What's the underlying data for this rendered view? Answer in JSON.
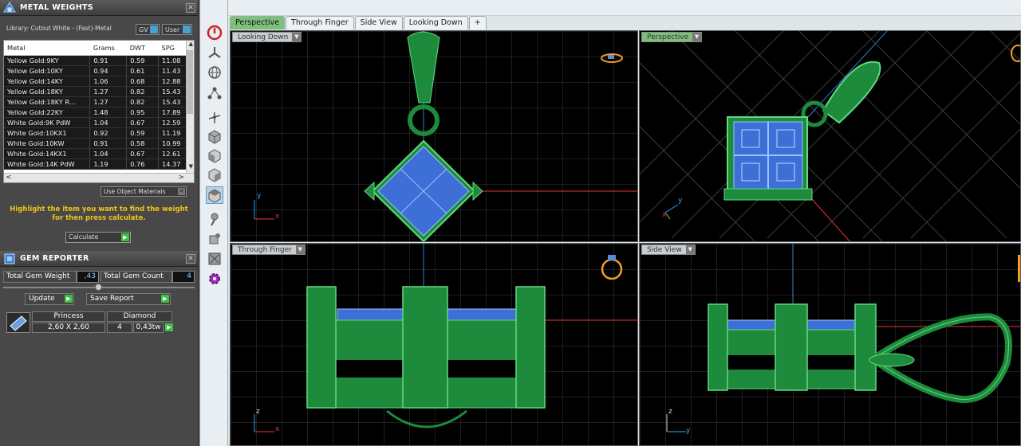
{
  "metal_weights": {
    "title": "METAL WEIGHTS",
    "library": "Library: Cutout White - (Fast)-Metal",
    "gv_label": "GV",
    "user_label": "User",
    "columns": [
      "Metal",
      "Grams",
      "DWT",
      "SPG"
    ],
    "rows": [
      [
        "Yellow Gold:9KY",
        "0.91",
        "0.59",
        "11.08"
      ],
      [
        "Yellow Gold:10KY",
        "0.94",
        "0.61",
        "11.43"
      ],
      [
        "Yellow Gold:14KY",
        "1.06",
        "0.68",
        "12.88"
      ],
      [
        "Yellow Gold:18KY",
        "1.27",
        "0.82",
        "15.43"
      ],
      [
        "Yellow Gold:18KY R...",
        "1.27",
        "0.82",
        "15.43"
      ],
      [
        "Yellow Gold:22KY",
        "1.48",
        "0.95",
        "17.89"
      ],
      [
        "White Gold:9K PdW",
        "1.04",
        "0.67",
        "12.59"
      ],
      [
        "White Gold:10KX1",
        "0.92",
        "0.59",
        "11.19"
      ],
      [
        "White Gold:10KW",
        "0.91",
        "0.58",
        "10.99"
      ],
      [
        "White Gold:14KX1",
        "1.04",
        "0.67",
        "12.61"
      ],
      [
        "White Gold:14K PdW",
        "1.19",
        "0.76",
        "14.37"
      ]
    ],
    "use_object_materials": "Use Object Materials",
    "hint": "Highlight the item you want to find the weight for then press calculate.",
    "calculate_label": "Calculate"
  },
  "gem_reporter": {
    "title": "GEM REPORTER",
    "total_weight_label": "Total Gem Weight",
    "total_weight_value": ",43",
    "total_count_label": "Total Gem Count",
    "total_count_value": "4",
    "update_label": "Update",
    "save_report_label": "Save Report",
    "gem": {
      "cut": "Princess",
      "size": "2,60 X 2,60",
      "stone": "Diamond",
      "count": "4",
      "weight": "0,43tw"
    }
  },
  "tabs": [
    "Perspective",
    "Through Finger",
    "Side View",
    "Looking Down",
    "+"
  ],
  "active_tab_index": 0,
  "viewports": {
    "top_left": "Looking Down",
    "top_right": "Perspective",
    "bottom_left": "Through Finger",
    "bottom_right": "Side View"
  },
  "axes": {
    "top_left": [
      "y",
      "x"
    ],
    "top_right": [
      "y",
      "x"
    ],
    "bottom_left": [
      "z",
      "x"
    ],
    "bottom_right": [
      "z",
      "y"
    ]
  },
  "colors": {
    "metal": "#1e8a3c",
    "gem": "#3d6fd6",
    "accent_tab": "#7cc07a",
    "hint": "#f0c419"
  }
}
